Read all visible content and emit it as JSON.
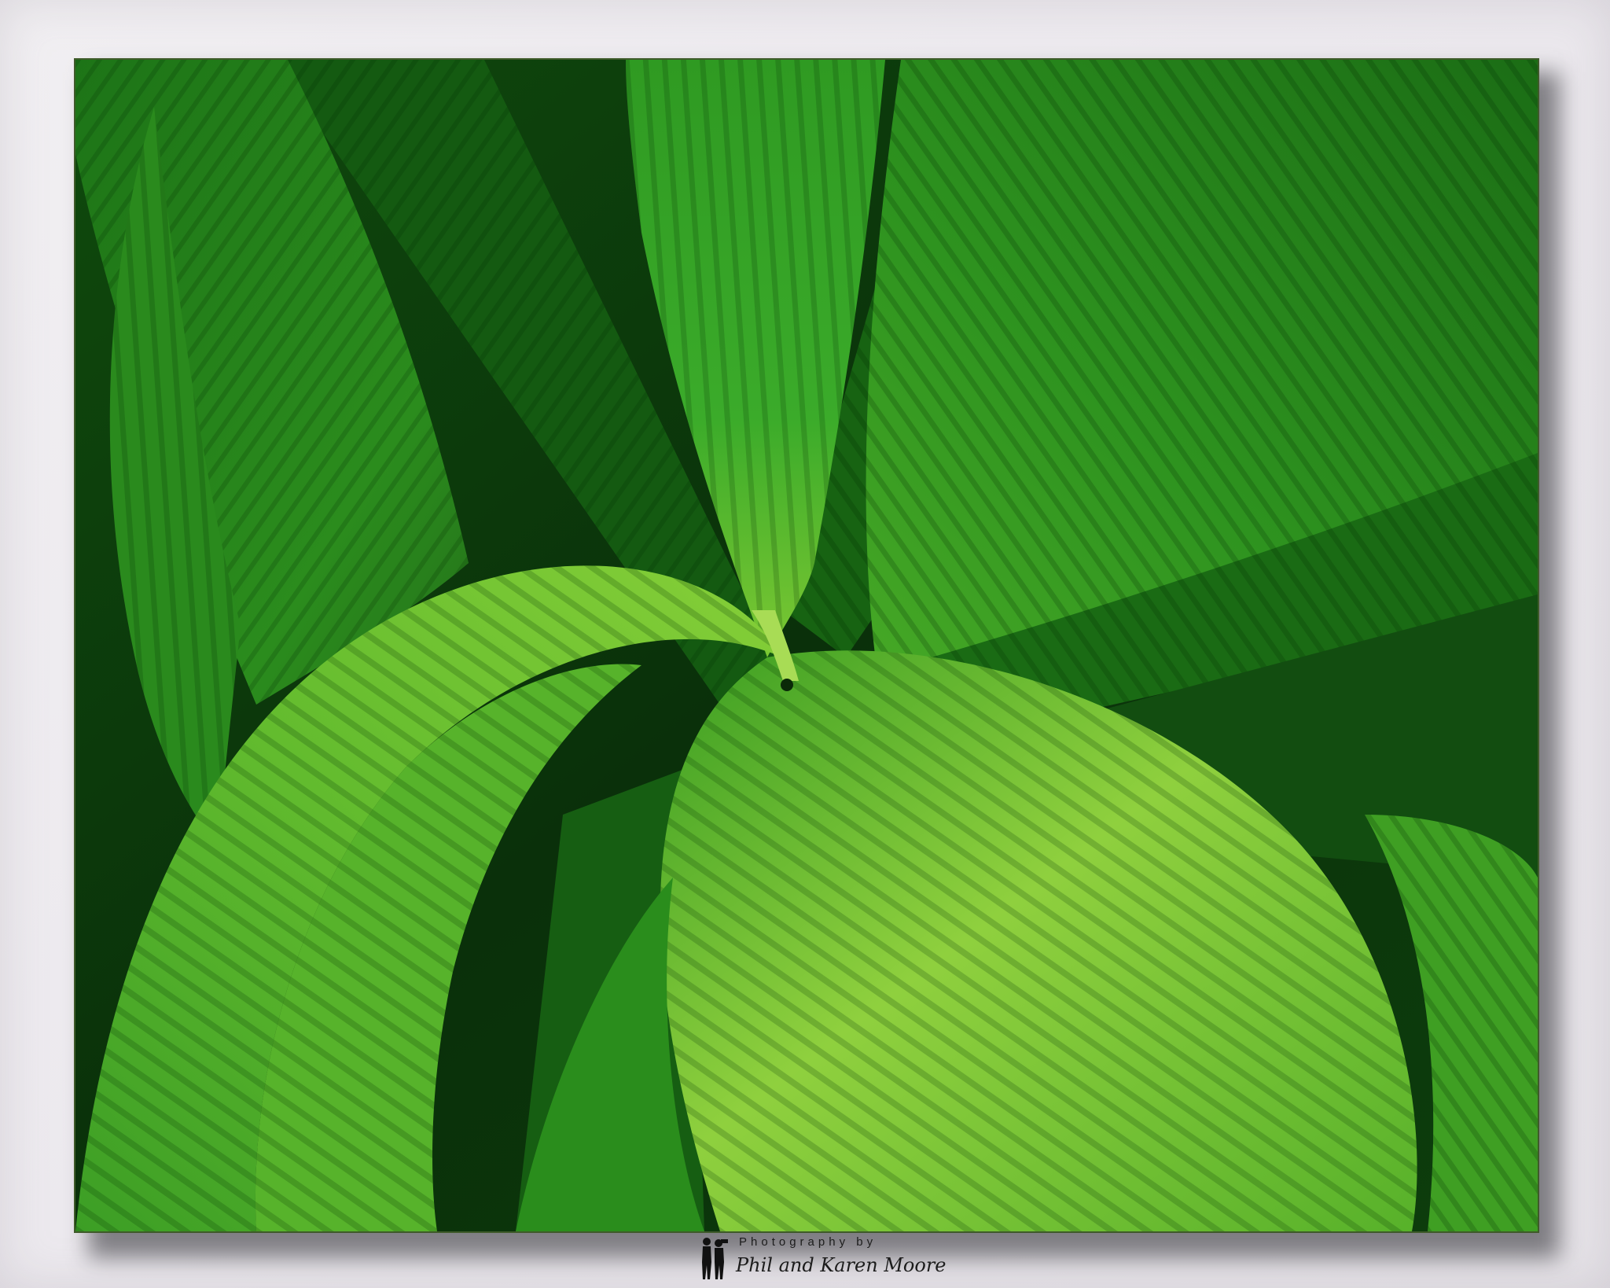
{
  "photo": {
    "subject": "green-leaves-icon",
    "colors": {
      "dark_green": "#0d3d0c",
      "mid_green": "#1f7a17",
      "bright_green": "#3fa829",
      "light_green": "#8ed23c",
      "frame_background": "#ecebee"
    }
  },
  "credit": {
    "line1": "Photography by",
    "line2": "Phil and Karen Moore",
    "icon": "photographers-silhouette-icon"
  }
}
